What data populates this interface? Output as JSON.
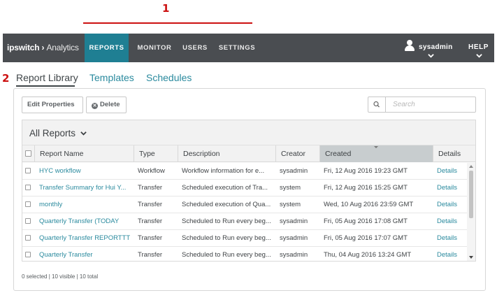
{
  "annotations": {
    "marker_1": "1",
    "marker_2": "2"
  },
  "app": {
    "logo_brand": "ipswitch",
    "logo_product": "Analytics"
  },
  "nav": {
    "items": [
      {
        "label": "REPORTS",
        "active": true
      },
      {
        "label": "MONITOR"
      },
      {
        "label": "USERS"
      },
      {
        "label": "SETTINGS"
      }
    ],
    "user": "sysadmin",
    "help": "HELP"
  },
  "subtabs": [
    {
      "label": "Report Library",
      "active": true
    },
    {
      "label": "Templates"
    },
    {
      "label": "Schedules"
    }
  ],
  "toolbar": {
    "edit_properties": "Edit Properties",
    "delete": "Delete",
    "search_placeholder": "Search"
  },
  "table": {
    "view_label": "All Reports",
    "columns": [
      "Report Name",
      "Type",
      "Description",
      "Creator",
      "Created",
      "Details"
    ],
    "sorted_column": "Created",
    "rows": [
      {
        "name": "HYC workflow",
        "type": "Workflow",
        "description": "Workflow information for e...",
        "creator": "sysadmin",
        "created": "Fri, 12 Aug 2016 19:23 GMT",
        "details": "Details"
      },
      {
        "name": "Transfer Summary for Hui Y...",
        "type": "Transfer",
        "description": "Scheduled execution of Tra...",
        "creator": "system",
        "created": "Fri, 12 Aug 2016 15:25 GMT",
        "details": "Details"
      },
      {
        "name": "monthly",
        "type": "Transfer",
        "description": "Scheduled execution of Qua...",
        "creator": "system",
        "created": "Wed, 10 Aug 2016 23:59 GMT",
        "details": "Details"
      },
      {
        "name": "Quarterly Transfer (TODAY",
        "type": "Transfer",
        "description": "Scheduled to Run every beg...",
        "creator": "sysadmin",
        "created": "Fri, 05 Aug 2016 17:08 GMT",
        "details": "Details"
      },
      {
        "name": "Quarterly Transfer REPORTTT",
        "type": "Transfer",
        "description": "Scheduled to Run every beg...",
        "creator": "sysadmin",
        "created": "Fri, 05 Aug 2016 17:07 GMT",
        "details": "Details"
      },
      {
        "name": "Quarterly Transfer",
        "type": "Transfer",
        "description": "Scheduled to Run every beg...",
        "creator": "sysadmin",
        "created": "Thu, 04 Aug 2016 13:24 GMT",
        "details": "Details"
      }
    ]
  },
  "status": "0 selected | 10 visible | 10 total",
  "colors": {
    "nav_bg": "#4a4d51",
    "accent": "#1f7f93",
    "link": "#2a8a9e",
    "callout": "#cc1111"
  }
}
